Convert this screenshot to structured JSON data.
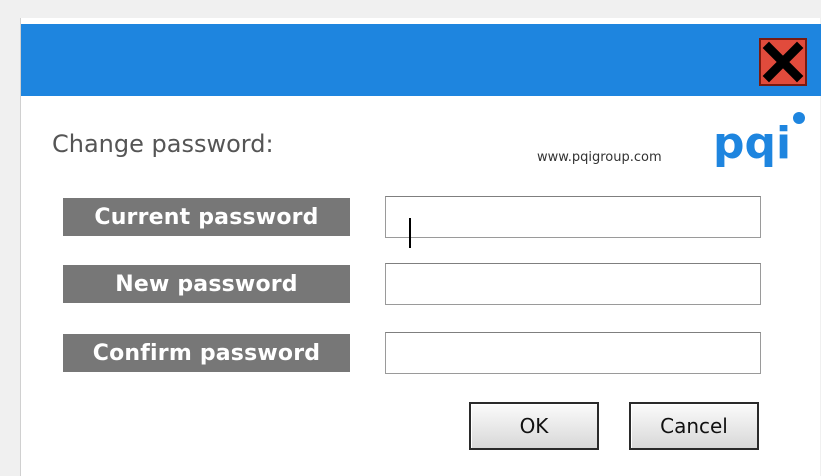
{
  "dialog": {
    "title": "Change password:",
    "website": "www.pqigroup.com",
    "logo_text": "pqi",
    "accent_color": "#1e85df",
    "close_icon": "close-x-icon"
  },
  "fields": [
    {
      "label": "Current password",
      "value": "",
      "placeholder": ""
    },
    {
      "label": "New password",
      "value": "",
      "placeholder": ""
    },
    {
      "label": "Confirm password",
      "value": "",
      "placeholder": ""
    }
  ],
  "buttons": {
    "ok": "OK",
    "cancel": "Cancel"
  }
}
